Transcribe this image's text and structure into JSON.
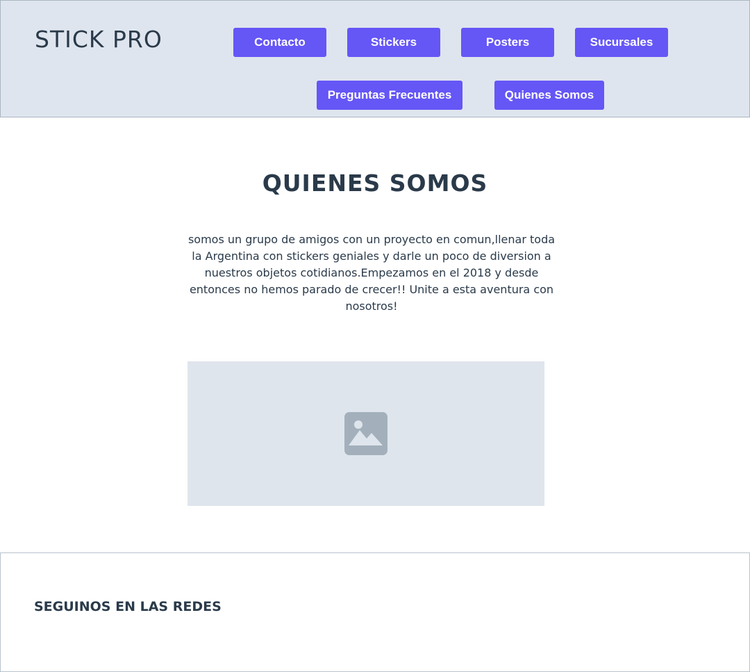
{
  "header": {
    "logo": "STICK PRO",
    "nav": [
      {
        "label": "Contacto"
      },
      {
        "label": "Stickers"
      },
      {
        "label": "Posters"
      },
      {
        "label": "Sucursales"
      },
      {
        "label": "Preguntas Frecuentes"
      },
      {
        "label": "Quienes Somos"
      }
    ]
  },
  "main": {
    "title": "QUIENES SOMOS",
    "intro": "somos un grupo de amigos con un proyecto en comun,llenar toda la Argentina con stickers geniales y darle un poco de diversion a nuestros objetos cotidianos.Empezamos en el 2018 y desde entonces no hemos parado de crecer!! Unite a esta aventura con nosotros!",
    "image_icon": "image-placeholder-icon"
  },
  "footer": {
    "title": "SEGUINOS EN LAS REDES"
  },
  "colors": {
    "accent": "#6556f6",
    "header_bg": "#dfe5ee",
    "text": "#2a3a4a",
    "placeholder_bg": "#dfe5ec",
    "placeholder_icon": "#a3b0bc"
  }
}
